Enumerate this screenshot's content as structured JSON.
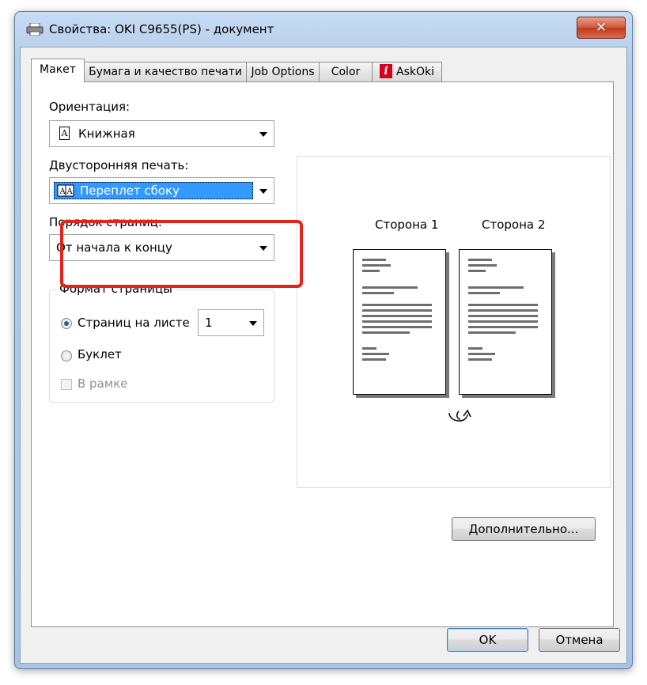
{
  "window": {
    "title": "Свойства: OKI C9655(PS) - документ",
    "close_symbol": "✕"
  },
  "tabs": [
    {
      "label": "Макет",
      "active": true
    },
    {
      "label": "Бумага и качество печати",
      "active": false
    },
    {
      "label": "Job Options",
      "active": false
    },
    {
      "label": "Color",
      "active": false
    },
    {
      "label": "AskOki",
      "active": false,
      "icon": "info-icon",
      "icon_glyph": "i"
    }
  ],
  "orientation": {
    "label": "Ориентация:",
    "value": "Книжная",
    "icon": "portrait-page-icon",
    "icon_glyph": "A"
  },
  "duplex": {
    "label": "Двусторонняя печать:",
    "value": "Переплет сбоку",
    "icon": "book-icon",
    "highlight_color": "#e0261a",
    "selection_color": "#3399ff"
  },
  "page_order": {
    "label": "Порядок страниц:",
    "value": "От начала к концу"
  },
  "page_format": {
    "legend": "Формат страницы",
    "pages_per_sheet_label": "Страниц на листе",
    "pages_per_sheet_value": "1",
    "booklet_label": "Буклет",
    "border_label": "В рамке",
    "selected": "pages_per_sheet",
    "border_checked": false,
    "border_enabled": false
  },
  "preview": {
    "side1": "Сторона 1",
    "side2": "Сторона 2",
    "flip_icon": "flip-arrow-icon"
  },
  "buttons": {
    "advanced": "Дополнительно...",
    "ok": "OK",
    "cancel": "Отмена"
  }
}
